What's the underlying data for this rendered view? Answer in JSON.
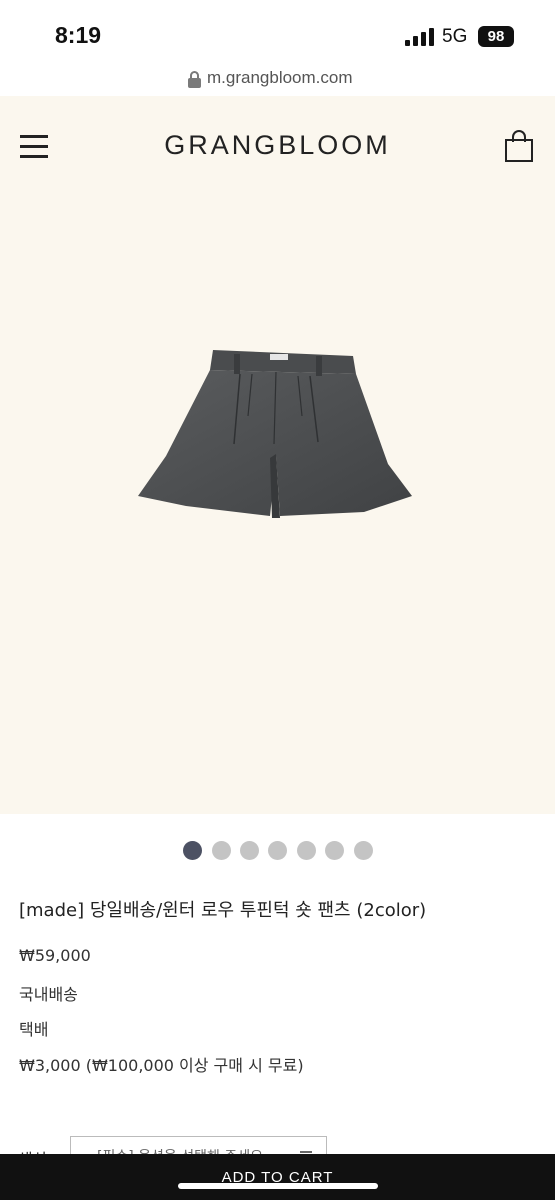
{
  "status_bar": {
    "time": "8:19",
    "network": "5G",
    "battery": "98"
  },
  "browser": {
    "url": "m.grangbloom.com"
  },
  "header": {
    "brand": "GRANGBLOOM",
    "menu_icon": "hamburger-menu-icon",
    "cart_icon": "shopping-bag-icon"
  },
  "gallery": {
    "image_description_icon": "shorts-product-image",
    "total_slides": 7,
    "active_slide": 1
  },
  "product": {
    "title": "[made] 당일배송/윈터 로우 투핀턱 숏 팬츠 (2color)",
    "price": "₩59,000",
    "shipping_region": "국내배송",
    "shipping_method": "택배",
    "shipping_fee": "₩3,000 (₩100,000 이상 구매 시 무료)"
  },
  "options": {
    "color_label": "색상",
    "color_placeholder": "[필수] 옵션을 선택해 주세요"
  },
  "actions": {
    "add_to_cart": "ADD TO CART"
  },
  "colors": {
    "hero_background": "#fbf7ee",
    "active_dot": "#4c5163",
    "inactive_dot": "#c4c4c4",
    "cart_bar": "#111111"
  }
}
